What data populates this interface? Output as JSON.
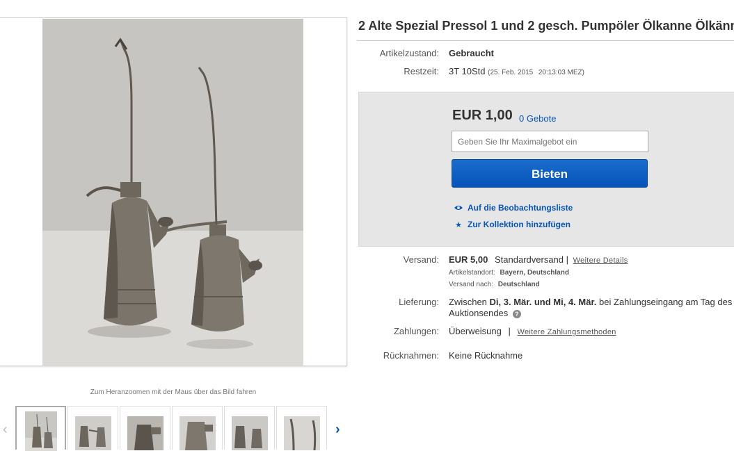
{
  "title": "2 Alte Spezial Pressol 1 und 2 gesch. Pumpöler Ölkanne Ölkänn",
  "condition": {
    "label": "Artikelzustand:",
    "value": "Gebraucht"
  },
  "time_left": {
    "label": "Restzeit:",
    "value": "3T 10Std",
    "date": "(25. Feb. 2015",
    "time": "20:13:03 MEZ)"
  },
  "bid": {
    "price": "EUR 1,00",
    "bid_count": "0 Gebote",
    "input_placeholder": "Geben Sie Ihr Maximalgebot ein",
    "button_label": "Bieten",
    "watchlist_label": "Auf die Beobachtungsliste",
    "collection_label": "Zur Kollektion hinzufügen",
    "watchlist_icon": "eye-icon",
    "collection_icon": "star-icon"
  },
  "shipping": {
    "label": "Versand:",
    "price": "EUR 5,00",
    "method": "Standardversand |",
    "details_link": "Weitere Details",
    "location_label": "Artikelstandort:",
    "location": "Bayern, Deutschland",
    "ships_to_label": "Versand nach:",
    "ships_to": "Deutschland"
  },
  "delivery": {
    "label": "Lieferung:",
    "prefix": "Zwischen",
    "range": "Di, 3. Mär. und Mi, 4. Mär.",
    "suffix": "bei Zahlungseingang am Tag des",
    "line2": "Auktionsendes",
    "help_icon": "?"
  },
  "payment": {
    "label": "Zahlungen:",
    "method": "Überweisung",
    "separator": "|",
    "more_link": "Weitere Zahlungsmethoden"
  },
  "returns": {
    "label": "Rücknahmen:",
    "value": "Keine Rücknahme"
  },
  "gallery": {
    "zoom_hint": "Zum Heranzoomen mit der Maus über das Bild fahren",
    "prev_icon": "chevron-left-icon",
    "next_icon": "chevron-right-icon",
    "prev_glyph": "‹",
    "next_glyph": "›",
    "thumbnail_count": 6
  },
  "colors": {
    "link": "#0654ba",
    "button": "#0654ba",
    "bid_box": "#e6e6e6"
  }
}
